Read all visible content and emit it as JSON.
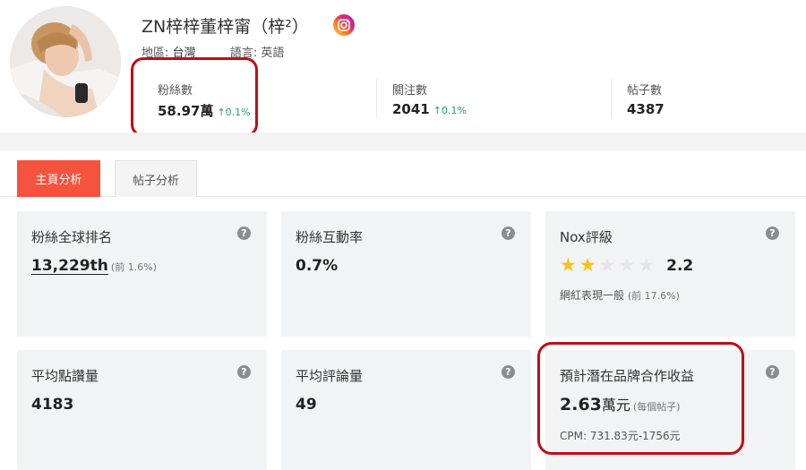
{
  "profile": {
    "name": "ZN梓梓董梓甯（梓²）",
    "platform_icon": "instagram-icon",
    "region_label": "地區:",
    "region_value": "台灣",
    "language_label": "語言:",
    "language_value": "英語"
  },
  "stats": {
    "followers": {
      "label": "粉絲數",
      "value": "58.97萬",
      "change": "0.1%"
    },
    "following": {
      "label": "關注數",
      "value": "2041",
      "change": "0.1%"
    },
    "posts": {
      "label": "帖子數",
      "value": "4387"
    }
  },
  "tabs": [
    {
      "label": "主頁分析",
      "active": true
    },
    {
      "label": "帖子分析",
      "active": false
    }
  ],
  "cards": {
    "global_rank": {
      "title": "粉絲全球排名",
      "value": "13,229th",
      "sub": "(前 1.6%)"
    },
    "engagement": {
      "title": "粉絲互動率",
      "value": "0.7%"
    },
    "nox_rating": {
      "title": "Nox評級",
      "stars_filled": 2,
      "stars_total": 5,
      "value": "2.2",
      "note": "網紅表現一般",
      "note_sub": "(前 17.6%)"
    },
    "avg_likes": {
      "title": "平均點讚量",
      "value": "4183"
    },
    "avg_comments": {
      "title": "平均評論量",
      "value": "49"
    },
    "earnings": {
      "title": "預計潛在品牌合作收益",
      "value": "2.63",
      "unit": "萬元",
      "sub": "(每個帖子)",
      "cpm": "CPM: 731.83元-1756元"
    }
  },
  "colors": {
    "accent_tab": "#f5533d",
    "highlight_border": "#c00e14",
    "positive_change": "#22a36b",
    "star_on": "#f5c518",
    "card_bg": "#f2f3f5"
  }
}
